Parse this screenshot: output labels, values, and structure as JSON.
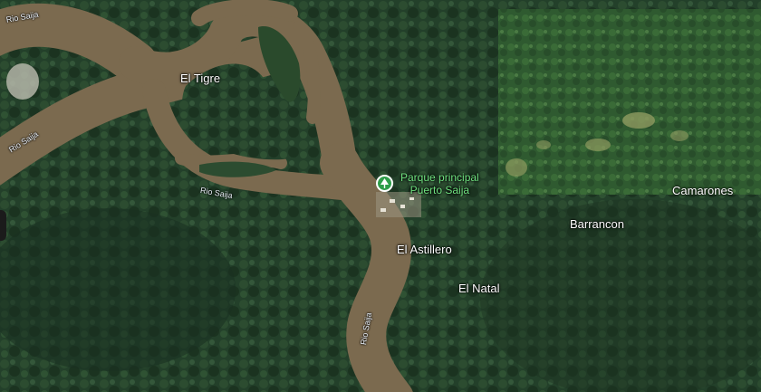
{
  "map": {
    "view": "satellite",
    "places": {
      "el_tigre": "El Tigre",
      "el_astillero": "El Astillero",
      "el_natal": "El Natal",
      "barrancon": "Barrancon",
      "camarones": "Camarones"
    },
    "rivers": {
      "label_top_left": "Rio Saija",
      "label_left": "Rio Saija",
      "label_middle": "Rio Saija",
      "label_lower": "Rio Saija"
    },
    "poi": {
      "line1": "Parque principal",
      "line2": "Puerto Saija",
      "icon": "park-tree-icon",
      "color": "#2e9d4a"
    }
  },
  "colors": {
    "forest_dark": "#1f3a22",
    "forest": "#2a4a2c",
    "forest_light": "#3f6a3a",
    "river": "#7b6a4f",
    "poi_text": "#6fe07f",
    "label_text": "#ffffff"
  }
}
